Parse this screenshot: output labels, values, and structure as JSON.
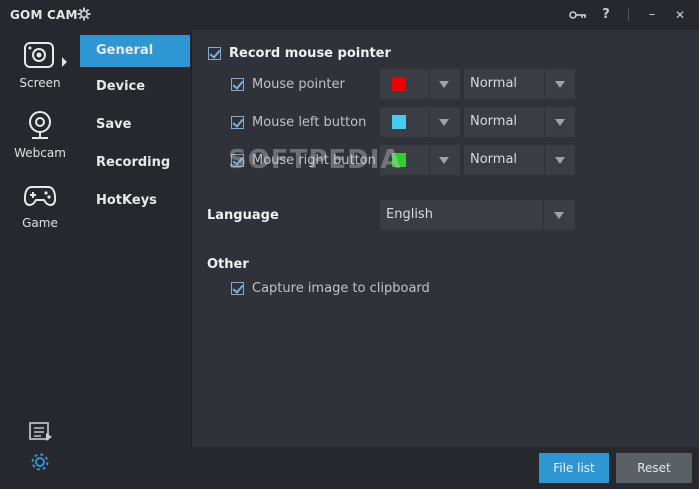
{
  "app": {
    "title": "GOM CAM"
  },
  "titlebar": {
    "icons": [
      "gear-icon",
      "key-icon",
      "help-icon",
      "minimize-icon",
      "close-icon"
    ],
    "help": "?",
    "minimize": "–",
    "close": "✕"
  },
  "nav": {
    "items": [
      {
        "label": "Screen",
        "icon": "screen-capture-icon"
      },
      {
        "label": "Webcam",
        "icon": "webcam-icon"
      },
      {
        "label": "Game",
        "icon": "gamepad-icon"
      }
    ],
    "bottom_icons": [
      "file-list-icon",
      "settings-icon"
    ]
  },
  "categories": {
    "items": [
      {
        "label": "General",
        "active": true
      },
      {
        "label": "Device",
        "active": false
      },
      {
        "label": "Save",
        "active": false
      },
      {
        "label": "Recording",
        "active": false
      },
      {
        "label": "HotKeys",
        "active": false
      }
    ]
  },
  "settings": {
    "record_mouse_pointer": {
      "label": "Record mouse pointer",
      "checked": true
    },
    "pointer_rows": [
      {
        "label": "Mouse pointer",
        "checked": true,
        "color": "#ee0000",
        "size": "Normal"
      },
      {
        "label": "Mouse left button",
        "checked": true,
        "color": "#44ccee",
        "size": "Normal"
      },
      {
        "label": "Mouse right button",
        "checked": true,
        "color": "#33cc33",
        "size": "Normal"
      }
    ],
    "language": {
      "label": "Language",
      "value": "English"
    },
    "other": {
      "label": "Other",
      "capture_clipboard": {
        "label": "Capture image to clipboard",
        "checked": true
      }
    }
  },
  "watermark": "SOFTPEDIA",
  "footer": {
    "file_list": "File list",
    "reset": "Reset"
  },
  "colors": {
    "accent": "#2e96d2",
    "background": "#2f3238",
    "sidebar": "#26282d"
  }
}
